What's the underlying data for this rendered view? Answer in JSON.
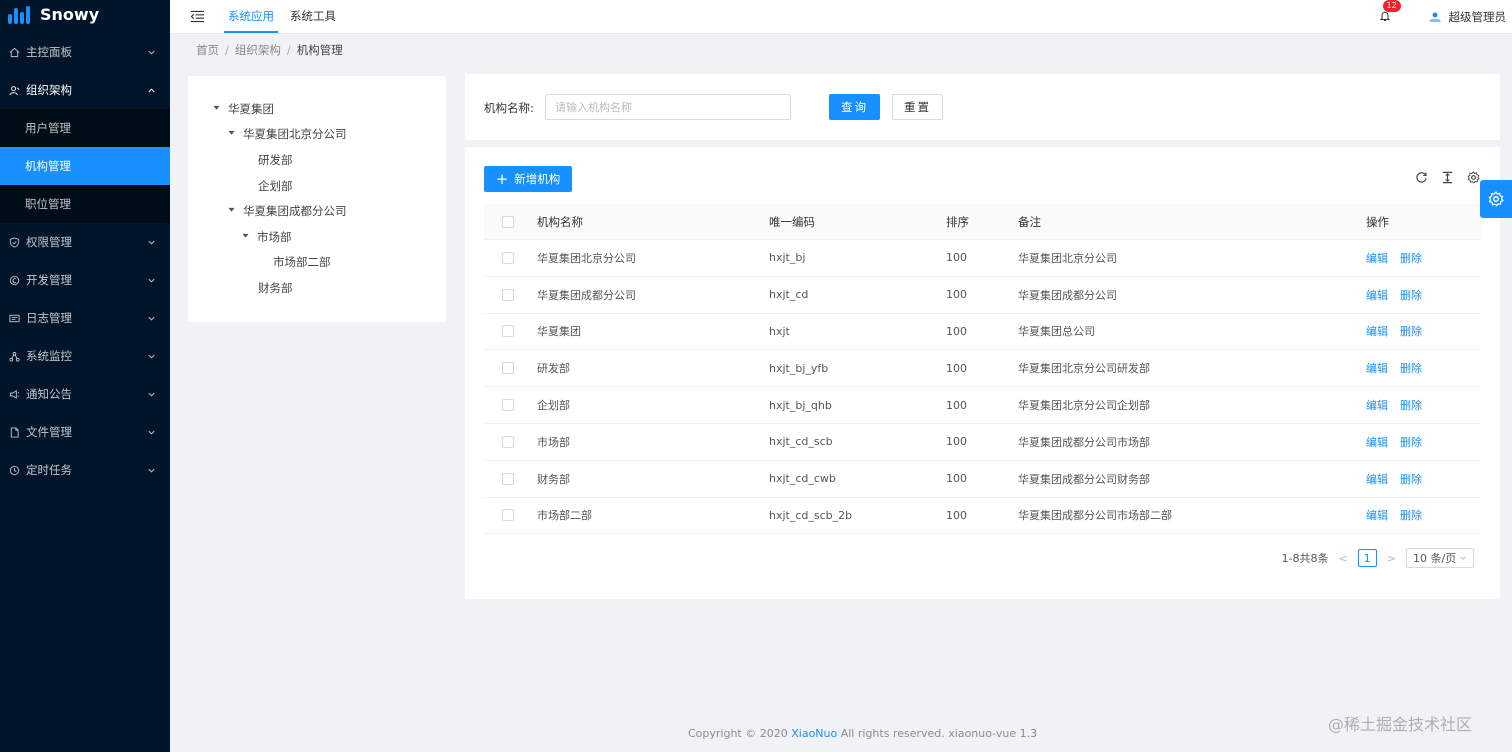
{
  "app": {
    "name": "Snowy"
  },
  "sidebar": {
    "items": [
      {
        "label": "主控面板",
        "icon": "home-icon"
      },
      {
        "label": "组织架构",
        "icon": "org-icon",
        "open": true,
        "children": [
          {
            "label": "用户管理"
          },
          {
            "label": "机构管理",
            "active": true
          },
          {
            "label": "职位管理"
          }
        ]
      },
      {
        "label": "权限管理",
        "icon": "shield-icon"
      },
      {
        "label": "开发管理",
        "icon": "dev-icon"
      },
      {
        "label": "日志管理",
        "icon": "log-icon"
      },
      {
        "label": "系统监控",
        "icon": "monitor-icon"
      },
      {
        "label": "通知公告",
        "icon": "notice-icon"
      },
      {
        "label": "文件管理",
        "icon": "file-icon"
      },
      {
        "label": "定时任务",
        "icon": "clock-icon"
      }
    ]
  },
  "header": {
    "tabs": [
      {
        "label": "系统应用",
        "active": true
      },
      {
        "label": "系统工具"
      }
    ],
    "badge_count": "12",
    "user_name": "超级管理员"
  },
  "breadcrumb": [
    "首页",
    "组织架构",
    "机构管理"
  ],
  "tree": [
    {
      "label": "华夏集团",
      "expanded": true
    },
    {
      "label": "华夏集团北京分公司",
      "expanded": true
    },
    {
      "label": "研发部"
    },
    {
      "label": "企划部"
    },
    {
      "label": "华夏集团成都分公司",
      "expanded": true
    },
    {
      "label": "市场部",
      "expanded": true
    },
    {
      "label": "市场部二部"
    },
    {
      "label": "财务部"
    }
  ],
  "search": {
    "label": "机构名称:",
    "placeholder": "请输入机构名称",
    "query_label": "查询",
    "reset_label": "重置"
  },
  "table": {
    "add_label": "新增机构",
    "columns": [
      "机构名称",
      "唯一编码",
      "排序",
      "备注",
      "操作"
    ],
    "rows": [
      {
        "name": "华夏集团北京分公司",
        "code": "hxjt_bj",
        "sort": "100",
        "remark": "华夏集团北京分公司"
      },
      {
        "name": "华夏集团成都分公司",
        "code": "hxjt_cd",
        "sort": "100",
        "remark": "华夏集团成都分公司"
      },
      {
        "name": "华夏集团",
        "code": "hxjt",
        "sort": "100",
        "remark": "华夏集团总公司"
      },
      {
        "name": "研发部",
        "code": "hxjt_bj_yfb",
        "sort": "100",
        "remark": "华夏集团北京分公司研发部"
      },
      {
        "name": "企划部",
        "code": "hxjt_bj_qhb",
        "sort": "100",
        "remark": "华夏集团北京分公司企划部"
      },
      {
        "name": "市场部",
        "code": "hxjt_cd_scb",
        "sort": "100",
        "remark": "华夏集团成都分公司市场部"
      },
      {
        "name": "财务部",
        "code": "hxjt_cd_cwb",
        "sort": "100",
        "remark": "华夏集团成都分公司财务部"
      },
      {
        "name": "市场部二部",
        "code": "hxjt_cd_scb_2b",
        "sort": "100",
        "remark": "华夏集团成都分公司市场部二部"
      }
    ],
    "edit_label": "编辑",
    "delete_label": "删除"
  },
  "pagination": {
    "summary": "1-8共8条",
    "current_page": "1",
    "page_size": "10 条/页"
  },
  "footer": {
    "prefix": "Copyright © 2020 ",
    "link": "XiaoNuo",
    "suffix": " All rights reserved. xiaonuo-vue 1.3"
  },
  "watermark": "@稀土掘金技术社区",
  "colors": {
    "primary": "#1890ff",
    "sidebar_bg": "#001529",
    "badge": "#f5222d"
  }
}
